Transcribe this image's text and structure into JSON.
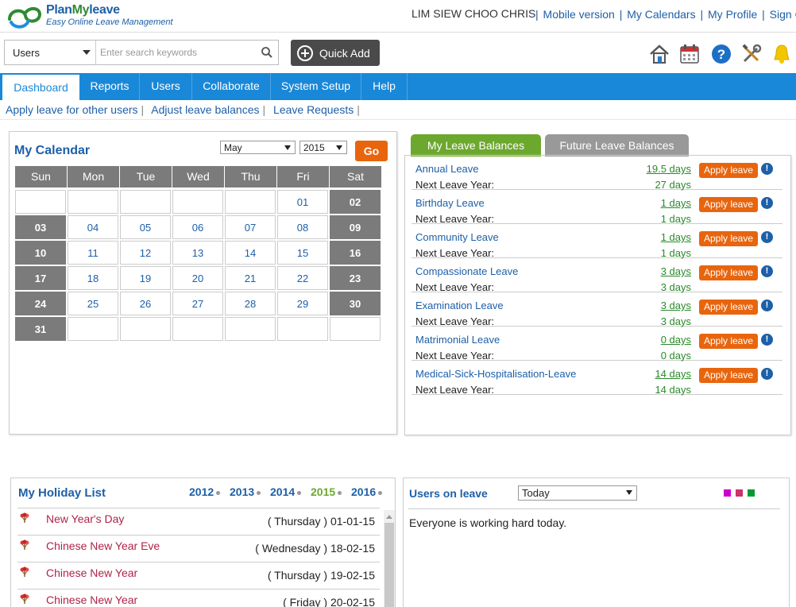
{
  "header": {
    "brand_plan": "Plan",
    "brand_my": "My",
    "brand_leave": "leave",
    "tagline": "Easy Online Leave Management",
    "user_name": "LIM SIEW CHOO CHRIS",
    "links": [
      "Mobile version",
      "My Calendars",
      "My Profile",
      "Sign Out"
    ]
  },
  "search": {
    "category": "Users",
    "placeholder": "Enter search keywords"
  },
  "quick_add_label": "Quick Add",
  "toolbar_icons": [
    "home-icon",
    "calendar-icon",
    "help-icon",
    "tools-icon",
    "bell-icon"
  ],
  "nav": [
    "Dashboard",
    "Reports",
    "Users",
    "Collaborate",
    "System Setup",
    "Help"
  ],
  "subnav": [
    "Apply leave for other users",
    "Adjust leave balances",
    "Leave Requests"
  ],
  "calendar": {
    "title": "My Calendar",
    "month": "May",
    "year": "2015",
    "go_label": "Go",
    "days": [
      "Sun",
      "Mon",
      "Tue",
      "Wed",
      "Thu",
      "Fri",
      "Sat"
    ],
    "weeks": [
      [
        "",
        "",
        "",
        "",
        "",
        "01",
        "02"
      ],
      [
        "03",
        "04",
        "05",
        "06",
        "07",
        "08",
        "09"
      ],
      [
        "10",
        "11",
        "12",
        "13",
        "14",
        "15",
        "16"
      ],
      [
        "17",
        "18",
        "19",
        "20",
        "21",
        "22",
        "23"
      ],
      [
        "24",
        "25",
        "26",
        "27",
        "28",
        "29",
        "30"
      ],
      [
        "31",
        "",
        "",
        "",
        "",
        "",
        ""
      ]
    ]
  },
  "leave_balances": {
    "tab_active": "My Leave Balances",
    "tab_inactive": "Future Leave Balances",
    "apply_label": "Apply leave",
    "next_label": "Next Leave Year:",
    "items": [
      {
        "name": "Annual Leave",
        "days": "19.5 days",
        "next": "27 days"
      },
      {
        "name": "Birthday Leave",
        "days": "1 days",
        "next": "1 days"
      },
      {
        "name": "Community Leave",
        "days": "1 days",
        "next": "1 days"
      },
      {
        "name": "Compassionate Leave",
        "days": "3 days",
        "next": "3 days"
      },
      {
        "name": "Examination Leave",
        "days": "3 days",
        "next": "3 days"
      },
      {
        "name": "Matrimonial Leave",
        "days": "0 days",
        "next": "0 days"
      },
      {
        "name": "Medical-Sick-Hospitalisation-Leave",
        "days": "14 days",
        "next": "14 days"
      }
    ]
  },
  "holidays": {
    "title": "My Holiday List",
    "years": [
      "2012",
      "2013",
      "2014",
      "2015",
      "2016"
    ],
    "current_year": "2015",
    "items": [
      {
        "name": "New Year's Day",
        "day": "( Thursday )",
        "date": "01-01-15"
      },
      {
        "name": "Chinese New Year Eve",
        "day": "( Wednesday )",
        "date": "18-02-15"
      },
      {
        "name": "Chinese New Year",
        "day": "( Thursday )",
        "date": "19-02-15"
      },
      {
        "name": "Chinese New Year",
        "day": "( Friday )",
        "date": "20-02-15"
      }
    ]
  },
  "users_on_leave": {
    "title": "Users on leave",
    "filter": "Today",
    "message": "Everyone is working hard today.",
    "swatch_colors": [
      "#cc00cc",
      "#cc3366",
      "#009933"
    ]
  }
}
